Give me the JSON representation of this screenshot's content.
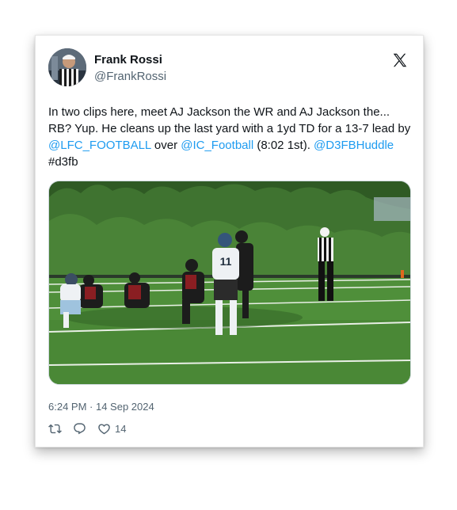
{
  "tweet": {
    "author_name": "Frank Rossi",
    "author_handle": "@FrankRossi",
    "text_part1": "In two clips here, meet AJ Jackson the WR and AJ Jackson the... RB? Yup. He cleans up the last yard with a 1yd TD for a 13-7 lead by ",
    "mention_1": "@LFC_FOOTBALL",
    "text_part2": " over ",
    "mention_2": "@IC_Football",
    "text_part3": " (8:02 1st). ",
    "mention_3": "@D3FBHuddle",
    "hashtag": "#d3fb",
    "timestamp": "6:24 PM · 14 Sep 2024",
    "like_count": "14"
  },
  "icons": {
    "platform": "x-logo-icon",
    "retweet": "retweet-icon",
    "reply": "reply-icon",
    "like": "heart-icon"
  },
  "colors": {
    "link": "#1d9bf0",
    "muted": "#536471",
    "text": "#0f1419"
  }
}
